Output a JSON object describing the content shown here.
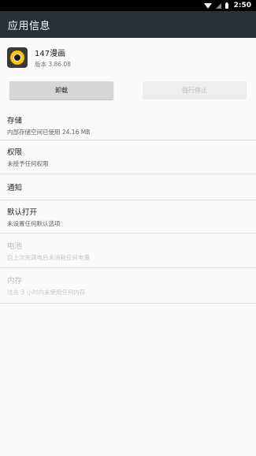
{
  "status_bar": {
    "time": "2:50",
    "icons": [
      "wifi-icon",
      "signal-icon",
      "battery-icon"
    ]
  },
  "toolbar": {
    "title": "应用信息"
  },
  "app": {
    "name": "147漫画",
    "version": "版本 3.86.08",
    "icon": "app-logo-icon"
  },
  "buttons": {
    "uninstall": "卸载",
    "force_stop": "强行停止"
  },
  "settings": [
    {
      "title": "存储",
      "summary": "内部存储空间已使用 24.16 MB",
      "enabled": true
    },
    {
      "title": "权限",
      "summary": "未授予任何权限",
      "enabled": true
    },
    {
      "title": "通知",
      "summary": "",
      "enabled": true
    },
    {
      "title": "默认打开",
      "summary": "未设置任何默认选项",
      "enabled": true
    },
    {
      "title": "电池",
      "summary": "自上次充满电后未消耗任何电量",
      "enabled": false
    },
    {
      "title": "内存",
      "summary": "过去 3 小时内未使用任何内存",
      "enabled": false
    }
  ],
  "colors": {
    "toolbar_bg": "#263238",
    "status_bar_bg": "#000000",
    "background": "#fafafa",
    "app_icon_accent": "#ffc400"
  }
}
